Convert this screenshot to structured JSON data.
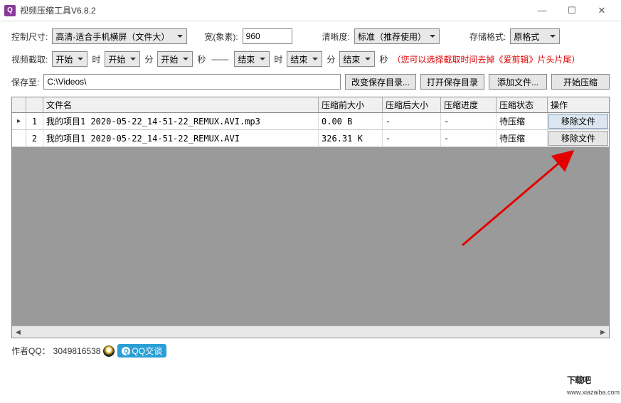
{
  "window": {
    "icon_letter": "Q",
    "title": "视频压缩工具V6.8.2"
  },
  "row1": {
    "size_label": "控制尺寸:",
    "size_value": "高清-适合手机横屏（文件大）",
    "width_label": "宽(象素):",
    "width_value": "960",
    "clarity_label": "清晰度:",
    "clarity_value": "标准（推荐使用）",
    "format_label": "存储格式:",
    "format_value": "原格式"
  },
  "row2": {
    "crop_label": "视频截取:",
    "start": "开始",
    "end": "结束",
    "hour": "时",
    "min": "分",
    "sec": "秒",
    "dashdash": "——",
    "hint": "（您可以选择截取时间去掉《爱剪辑》片头片尾）"
  },
  "row3": {
    "saveto_label": "保存至:",
    "path": "C:\\Videos\\",
    "change_dir": "改变保存目录...",
    "open_dir": "打开保存目录",
    "add_file": "添加文件...",
    "start_compress": "开始压缩"
  },
  "table": {
    "headers": {
      "filename": "文件名",
      "before": "压缩前大小",
      "after": "压缩后大小",
      "progress": "压缩进度",
      "status": "压缩状态",
      "op": "操作"
    },
    "rows": [
      {
        "marker": "▸",
        "num": "1",
        "name": "我的项目1 2020-05-22_14-51-22_REMUX.AVI.mp3",
        "before": "0.00 B",
        "after": "-",
        "progress": "-",
        "status": "待压缩",
        "op": "移除文件",
        "selected": true
      },
      {
        "marker": "",
        "num": "2",
        "name": "我的项目1 2020-05-22_14-51-22_REMUX.AVI",
        "before": "326.31 K",
        "after": "-",
        "progress": "-",
        "status": "待压缩",
        "op": "移除文件",
        "selected": false
      }
    ]
  },
  "footer": {
    "author_label": "作者QQ：",
    "author_qq": "3049816538",
    "qq_btn": "QQ交谈"
  },
  "watermark": {
    "main": "下载吧",
    "sub": "www.xiazaiba.com"
  }
}
